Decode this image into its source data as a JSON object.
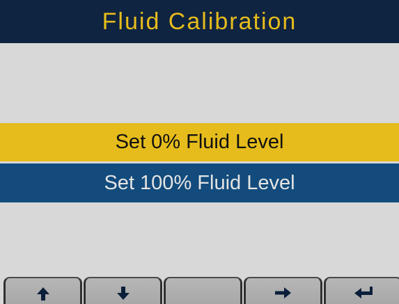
{
  "screen": {
    "title": "Fluid Calibration",
    "colors": {
      "title_bar_bg": "#0f2440",
      "title_text": "#e6bc1c",
      "selected_bg": "#e6bc1c",
      "unselected_bg": "#124b7c",
      "background": "#d8d8d8"
    }
  },
  "menu": {
    "items": [
      {
        "label": "Set 0% Fluid Level",
        "selected": true
      },
      {
        "label": "Set 100% Fluid Level",
        "selected": false
      }
    ]
  },
  "softkeys": [
    {
      "icon": "arrow-up-icon"
    },
    {
      "icon": "arrow-down-icon"
    },
    {
      "icon": ""
    },
    {
      "icon": "arrow-right-icon"
    },
    {
      "icon": "return-icon"
    }
  ]
}
